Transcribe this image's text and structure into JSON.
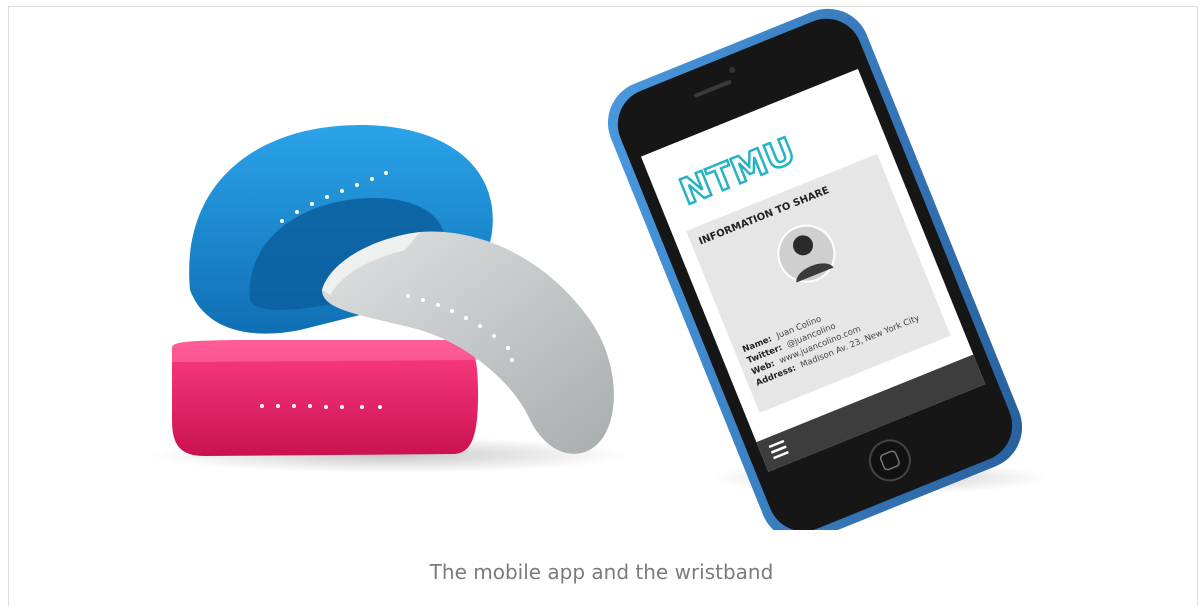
{
  "figure": {
    "caption": "The mobile app and the wristband"
  },
  "phone_app": {
    "logo": "NTMU",
    "section_title": "INFORMATION TO SHARE",
    "fields": [
      {
        "label": "Name:",
        "value": "Juan Colino"
      },
      {
        "label": "Twitter:",
        "value": "@juancolino"
      },
      {
        "label": "Web:",
        "value": "www.juancolino.com"
      },
      {
        "label": "Address:",
        "value": "Madison Av. 23, New York City"
      }
    ],
    "menu_icon": "hamburger-menu-icon"
  },
  "wristbands": [
    {
      "color": "#1e8fd6"
    },
    {
      "color": "#c8cccc"
    },
    {
      "color": "#e8206a"
    }
  ],
  "phone_case_color": "#3b7fc4"
}
